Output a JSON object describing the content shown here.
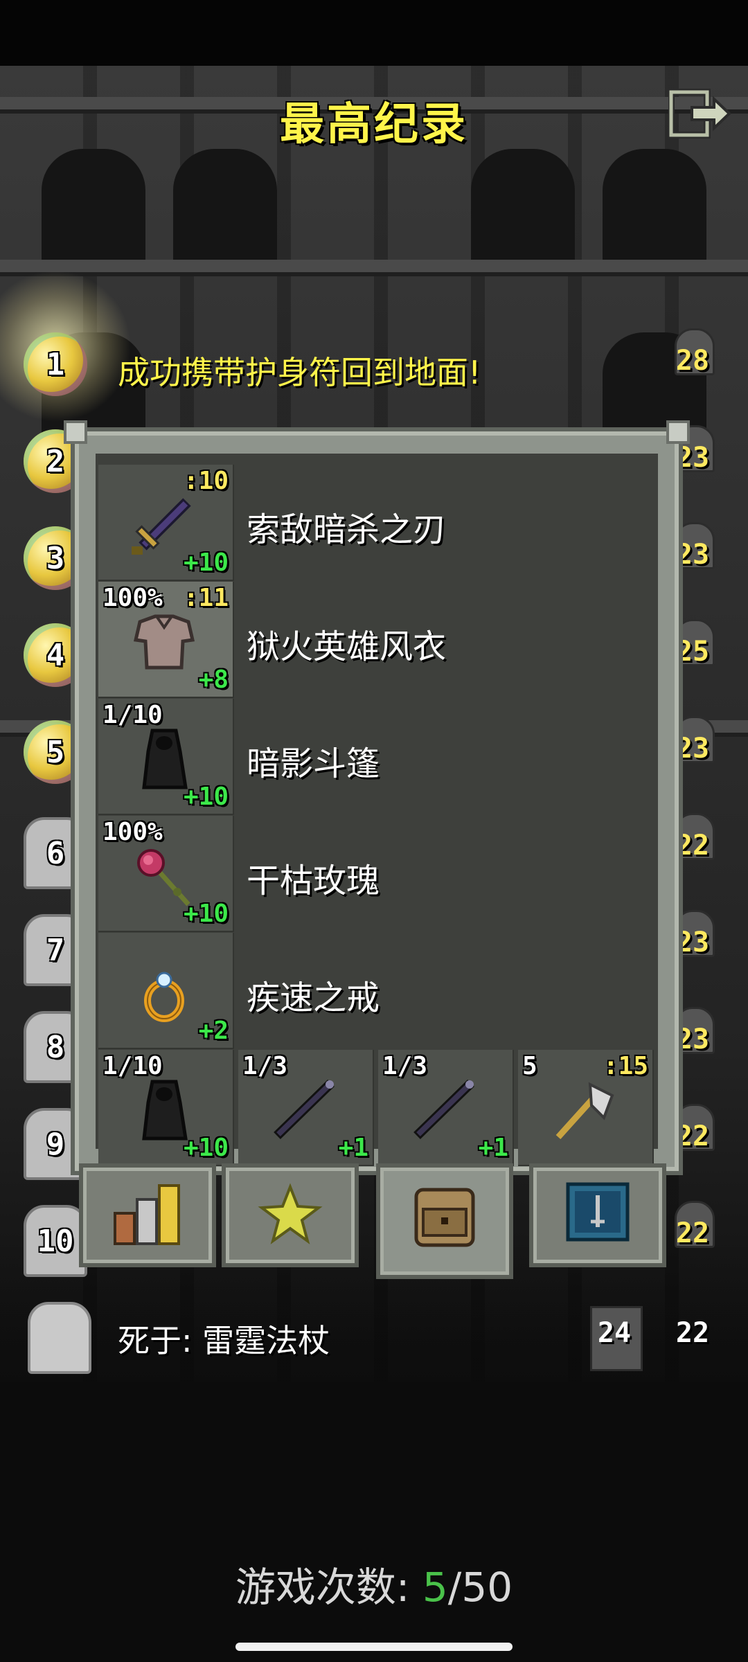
{
  "title": "最高纪录",
  "exit_icon": "exit-icon",
  "records": [
    {
      "rank": "1",
      "text": "成功携带护身符回到地面!",
      "depth": "28",
      "winner": true
    },
    {
      "rank": "2",
      "depth": "23",
      "winner": true
    },
    {
      "rank": "3",
      "depth": "23",
      "winner": true
    },
    {
      "rank": "4",
      "depth": "25",
      "winner": true
    },
    {
      "rank": "5",
      "depth": "23",
      "winner": true
    },
    {
      "rank": "6",
      "depth": "22",
      "winner": false
    },
    {
      "rank": "7",
      "depth": "23",
      "winner": false
    },
    {
      "rank": "8",
      "depth": "23",
      "winner": false
    },
    {
      "rank": "9",
      "depth": "22",
      "winner": false
    },
    {
      "rank": "10",
      "depth": "22",
      "winner": false
    }
  ],
  "equipment": [
    {
      "name": "索敌暗杀之刃",
      "icon": "dagger-icon",
      "top_left": "",
      "top_right": ":10",
      "bottom_right": "+10",
      "lit": false
    },
    {
      "name": "狱火英雄风衣",
      "icon": "armor-icon",
      "top_left": "100%",
      "top_right": ":11",
      "bottom_right": "+8",
      "lit": true
    },
    {
      "name": "暗影斗篷",
      "icon": "cloak-icon",
      "top_left": "1/10",
      "top_right": "",
      "bottom_right": "+10",
      "lit": false
    },
    {
      "name": "干枯玫瑰",
      "icon": "rose-icon",
      "top_left": "100%",
      "top_right": "",
      "bottom_right": "+10",
      "lit": false
    },
    {
      "name": "疾速之戒",
      "icon": "ring-icon",
      "top_left": "",
      "top_right": "",
      "bottom_right": "+2",
      "lit": false
    }
  ],
  "quickslots": [
    {
      "icon": "cloak-icon",
      "top_left": "1/10",
      "top_right": "",
      "bottom_right": "+10"
    },
    {
      "icon": "wand-icon",
      "top_left": "1/3",
      "top_right": "",
      "bottom_right": "+1"
    },
    {
      "icon": "wand-icon",
      "top_left": "1/3",
      "top_right": "",
      "bottom_right": "+1"
    },
    {
      "icon": "axe-icon",
      "top_left": "5",
      "top_right": ":15",
      "bottom_right": ""
    }
  ],
  "tabs": [
    {
      "icon": "stats-icon",
      "active": false
    },
    {
      "icon": "badges-icon",
      "active": false
    },
    {
      "icon": "backpack-icon",
      "active": true
    },
    {
      "icon": "journal-icon",
      "active": false
    }
  ],
  "death": {
    "text": "死于: 雷霆法杖",
    "depth": "24",
    "level": "22"
  },
  "games": {
    "label": "游戏次数: ",
    "current": "5",
    "sep": "/",
    "total": "50"
  }
}
